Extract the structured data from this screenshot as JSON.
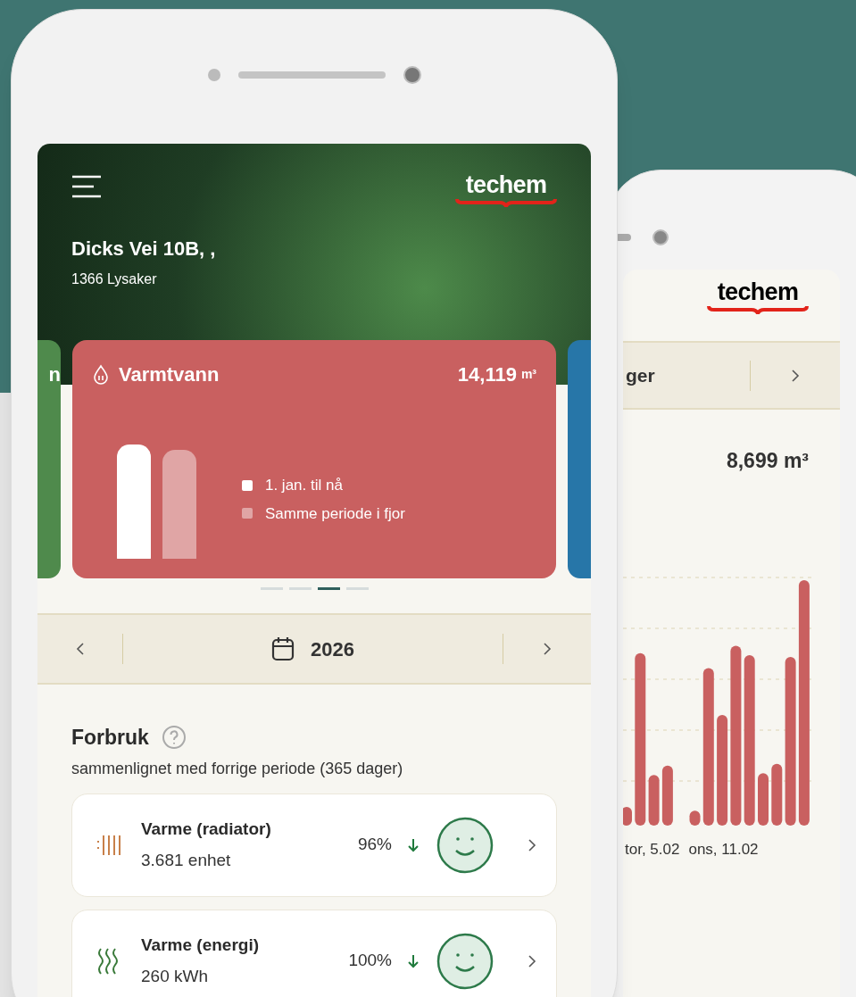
{
  "back_phone": {
    "logo": "techem",
    "period_label": "ger",
    "total": "8,699 m³",
    "chart_labels": [
      "tor, 5.02",
      "ons, 11.02"
    ]
  },
  "front_phone": {
    "logo": "techem",
    "address": "Dicks Vei 10B, ,",
    "city": "1366 Lysaker",
    "cards": [
      {
        "kind": "partial",
        "color": "#4f8a4c",
        "title": "n"
      },
      {
        "kind": "full",
        "color": "#c96060",
        "title": "Varmtvann",
        "total": "14,119",
        "unit": "m³",
        "legend": [
          "1. jan. til nå",
          "Samme periode i fjor"
        ]
      },
      {
        "kind": "partial",
        "color": "#2776a8"
      }
    ],
    "pager": [
      {
        "selected": false
      },
      {
        "selected": false
      },
      {
        "selected": true
      },
      {
        "selected": false
      }
    ],
    "year": "2026",
    "section": {
      "title": "Forbruk",
      "subtitle": "sammenlignet med forrige periode (365 dager)"
    },
    "items": [
      {
        "kind": "radiator",
        "name": "Varme (radiator)",
        "amount": "3.681 enhet",
        "percent": "96%",
        "trend_down": true
      },
      {
        "kind": "energy",
        "name": "Varme (energi)",
        "amount": "260 kWh",
        "percent": "100%",
        "trend_down": true
      }
    ]
  }
}
